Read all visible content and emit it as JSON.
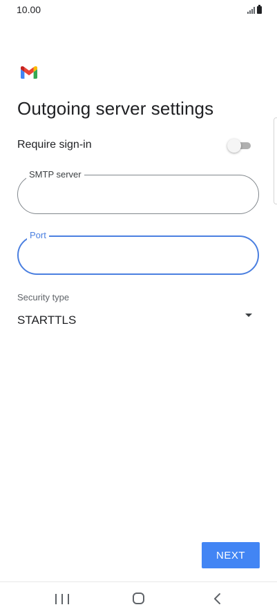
{
  "status_bar": {
    "time": "10.00",
    "icons": [
      "signal-icon",
      "battery-icon"
    ]
  },
  "app": {
    "logo": "gmail-logo",
    "colors": {
      "accent": "#4285f4",
      "field_focus": "#4a7fe0",
      "gmail_red": "#ea4335",
      "gmail_blue": "#4285f4",
      "gmail_green": "#34a853",
      "gmail_yellow": "#fbbc04"
    }
  },
  "page": {
    "title": "Outgoing server settings"
  },
  "require_signin": {
    "label": "Require sign-in",
    "enabled": false
  },
  "smtp_server": {
    "label": "SMTP server",
    "value": ""
  },
  "port": {
    "label": "Port",
    "value": "",
    "focused": true
  },
  "security": {
    "label": "Security type",
    "value": "STARTTLS"
  },
  "actions": {
    "next_label": "NEXT"
  },
  "navigation": {
    "icons": [
      "recents-icon",
      "home-icon",
      "back-icon"
    ]
  }
}
